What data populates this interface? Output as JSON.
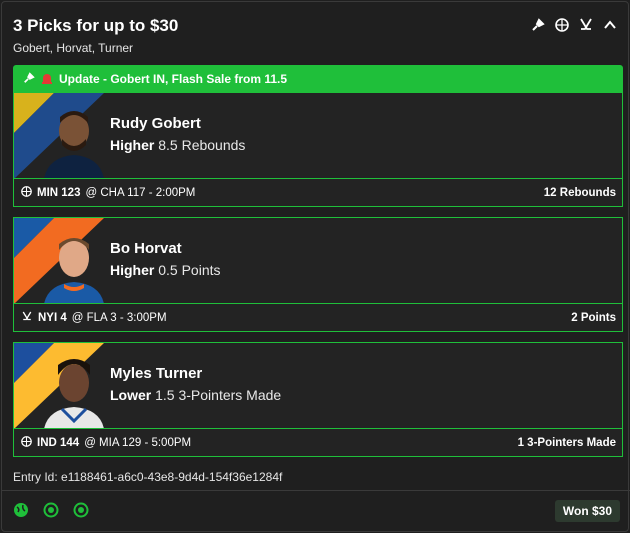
{
  "header": {
    "title": "3 Picks for up to $30",
    "subtitle": "Gobert, Horvat, Turner",
    "icons": [
      "flash-icon",
      "basketball-icon",
      "hockey-icon",
      "chevron-up-icon"
    ]
  },
  "banner": {
    "text": "Update - Gobert IN, Flash Sale from 11.5",
    "icons": [
      "flash-icon",
      "alert-icon"
    ]
  },
  "picks": [
    {
      "name": "Rudy Gobert",
      "direction": "Higher",
      "line": "8.5 Rebounds",
      "sport_icon": "basketball-icon",
      "team": "MIN 123",
      "matchup": "@ CHA 117 - 2:00PM",
      "result": "12 Rebounds",
      "stripe_colors": [
        "#d8b21c",
        "#1f4b8c"
      ]
    },
    {
      "name": "Bo Horvat",
      "direction": "Higher",
      "line": "0.5 Points",
      "sport_icon": "hockey-icon",
      "team": "NYI 4",
      "matchup": "@ FLA 3 - 3:00PM",
      "result": "2 Points",
      "stripe_colors": [
        "#f26b21",
        "#1a5aa6"
      ]
    },
    {
      "name": "Myles Turner",
      "direction": "Lower",
      "line": "1.5 3-Pointers Made",
      "sport_icon": "basketball-icon",
      "team": "IND 144",
      "matchup": "@ MIA 129 - 5:00PM",
      "result": "1 3-Pointers Made",
      "stripe_colors": [
        "#fdbb30",
        "#1d4f9e"
      ]
    }
  ],
  "entry_label": "Entry Id: e1188461-a6c0-43e8-9d4d-154f36e1284f",
  "footer": {
    "icons": [
      "globe-icon",
      "radio-check-icon",
      "radio-check-icon"
    ],
    "won_label": "Won $30"
  },
  "colors": {
    "accent": "#1fbf3a",
    "background": "#1f1f1f"
  }
}
